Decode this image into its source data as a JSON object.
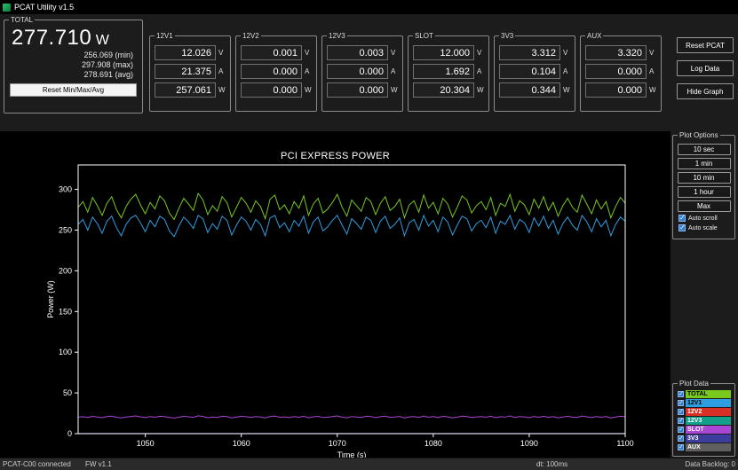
{
  "window": {
    "title": "PCAT Utility v1.5"
  },
  "total": {
    "label": "TOTAL",
    "value": "277.710",
    "unit": "W",
    "min": "256.069 (min)",
    "max": "297.908 (max)",
    "avg": "278.691 (avg)",
    "reset_button": "Reset Min/Max/Avg"
  },
  "units": {
    "volts": "V",
    "amps": "A",
    "watts": "W"
  },
  "channels": [
    {
      "label": "12V1",
      "volts": "12.026",
      "amps": "21.375",
      "watts": "257.061"
    },
    {
      "label": "12V2",
      "volts": "0.001",
      "amps": "0.000",
      "watts": "0.000"
    },
    {
      "label": "12V3",
      "volts": "0.003",
      "amps": "0.000",
      "watts": "0.000"
    },
    {
      "label": "SLOT",
      "volts": "12.000",
      "amps": "1.692",
      "watts": "20.304"
    },
    {
      "label": "3V3",
      "volts": "3.312",
      "amps": "0.104",
      "watts": "0.344"
    },
    {
      "label": "AUX",
      "volts": "3.320",
      "amps": "0.000",
      "watts": "0.000"
    }
  ],
  "actions": {
    "reset_pcat": "Reset PCAT",
    "log_data": "Log Data",
    "hide_graph": "Hide Graph"
  },
  "plot_options": {
    "label": "Plot Options",
    "buttons": [
      "10 sec",
      "1 min",
      "10 min",
      "1 hour",
      "Max"
    ],
    "checkboxes": [
      {
        "label": "Auto scroll",
        "checked": true
      },
      {
        "label": "Auto scale",
        "checked": true
      }
    ]
  },
  "plot_data": {
    "label": "Plot Data",
    "rows": [
      {
        "label": "TOTAL",
        "checked": true,
        "color": "#79c81e",
        "text_color": "#000000"
      },
      {
        "label": "12V1",
        "checked": true,
        "color": "#2f9ee0",
        "text_color": "#000000"
      },
      {
        "label": "12V2",
        "checked": true,
        "color": "#d93025",
        "text_color": "#ffffff"
      },
      {
        "label": "12V3",
        "checked": true,
        "color": "#12a08a",
        "text_color": "#ffffff"
      },
      {
        "label": "SLOT",
        "checked": true,
        "color": "#aa46d4",
        "text_color": "#ffffff"
      },
      {
        "label": "3V3",
        "checked": true,
        "color": "#3d3d9e",
        "text_color": "#ffffff"
      },
      {
        "label": "AUX",
        "checked": true,
        "color": "#606060",
        "text_color": "#ffffff"
      }
    ]
  },
  "statusbar": {
    "device": "PCAT-C00 connected",
    "firmware": "FW v1.1",
    "dt": "dt: 100ms",
    "backlog": "Data Backlog: 0"
  },
  "chart_data": {
    "type": "line",
    "title": "PCI EXPRESS POWER",
    "xlabel": "Time (s)",
    "ylabel": "Power (W)",
    "xlim": [
      1043,
      1100
    ],
    "ylim": [
      0,
      330
    ],
    "x_ticks": [
      1050,
      1060,
      1070,
      1080,
      1090,
      1100
    ],
    "y_ticks": [
      0,
      50,
      100,
      150,
      200,
      250,
      300
    ],
    "grid": false,
    "legend_position": "right-sidebar",
    "x": {
      "start": 1043,
      "step": 0.5,
      "count": 115
    },
    "series": [
      {
        "name": "12V2",
        "color": "#d93025",
        "values": 0.0
      },
      {
        "name": "12V3",
        "color": "#12a08a",
        "values": 0.0
      },
      {
        "name": "3V3",
        "color": "#3d3d9e",
        "values": 0.344
      },
      {
        "name": "AUX",
        "color": "#606060",
        "values": 0.0
      },
      {
        "name": "SLOT",
        "color": "#aa46d4",
        "values": [
          20.3,
          20.8,
          19.9,
          21.2,
          20.5,
          19.6,
          20.9,
          21.5,
          20.1,
          19.3,
          20.4,
          21.0,
          21.8,
          20.6,
          19.7,
          20.9,
          20.2,
          21.4,
          21.0,
          19.8,
          19.2,
          20.3,
          21.2,
          20.7,
          20.0,
          21.9,
          21.1,
          19.5,
          20.5,
          19.9,
          21.4,
          20.9,
          19.3,
          20.3,
          21.3,
          20.8,
          19.9,
          21.0,
          20.4,
          19.2,
          21.1,
          21.7,
          20.1,
          20.6,
          19.7,
          20.9,
          20.2,
          21.4,
          19.5,
          20.7,
          21.2,
          19.8,
          20.1,
          20.9,
          21.8,
          20.3,
          19.4,
          21.0,
          20.5,
          19.9,
          21.3,
          20.9,
          19.6,
          20.8,
          21.5,
          20.0,
          20.4,
          21.1,
          19.3,
          20.6,
          21.0,
          19.9,
          21.7,
          20.2,
          20.9,
          19.7,
          21.2,
          20.7,
          19.4,
          20.3,
          21.5,
          21.0,
          19.8,
          20.5,
          20.9,
          20.1,
          21.3,
          19.6,
          20.8,
          20.4,
          21.8,
          19.9,
          21.0,
          20.6,
          19.5,
          21.1,
          20.2,
          21.4,
          20.0,
          20.9,
          19.4,
          20.5,
          21.2,
          20.3,
          19.9,
          21.7,
          20.7,
          19.7,
          21.0,
          20.1,
          20.9,
          19.3,
          20.4,
          21.3,
          20.8
        ]
      },
      {
        "name": "12V1",
        "color": "#2f9ee0",
        "values": [
          257,
          263,
          250,
          266,
          258,
          246,
          261,
          267,
          253,
          243,
          257,
          265,
          268,
          259,
          248,
          262,
          254,
          267,
          263,
          249,
          242,
          255,
          266,
          260,
          252,
          268,
          264,
          247,
          258,
          251,
          267,
          262,
          244,
          256,
          266,
          261,
          250,
          263,
          257,
          243,
          265,
          268,
          253,
          259,
          248,
          262,
          255,
          267,
          246,
          260,
          266,
          249,
          254,
          262,
          268,
          256,
          245,
          264,
          258,
          251,
          266,
          262,
          247,
          261,
          267,
          252,
          257,
          265,
          243,
          259,
          263,
          250,
          268,
          255,
          262,
          248,
          266,
          260,
          244,
          256,
          267,
          264,
          249,
          258,
          262,
          253,
          266,
          246,
          261,
          257,
          268,
          251,
          263,
          259,
          247,
          265,
          255,
          267,
          252,
          262,
          245,
          258,
          266,
          256,
          250,
          268,
          260,
          248,
          264,
          254,
          262,
          243,
          257,
          266,
          261
        ]
      },
      {
        "name": "TOTAL",
        "color": "#79c81e",
        "values": [
          278,
          285,
          272,
          290,
          280,
          268,
          283,
          291,
          275,
          265,
          279,
          288,
          294,
          281,
          270,
          284,
          276,
          292,
          286,
          271,
          263,
          277,
          289,
          282,
          274,
          295,
          287,
          269,
          280,
          273,
          291,
          284,
          266,
          278,
          290,
          283,
          272,
          286,
          279,
          264,
          288,
          293,
          275,
          281,
          270,
          285,
          277,
          292,
          268,
          282,
          289,
          271,
          276,
          284,
          294,
          278,
          267,
          287,
          280,
          273,
          290,
          285,
          269,
          283,
          291,
          274,
          279,
          288,
          265,
          281,
          286,
          272,
          293,
          277,
          284,
          270,
          289,
          282,
          266,
          278,
          292,
          287,
          271,
          280,
          285,
          275,
          290,
          268,
          283,
          279,
          294,
          273,
          286,
          281,
          269,
          288,
          277,
          291,
          274,
          284,
          267,
          280,
          289,
          278,
          272,
          293,
          282,
          270,
          287,
          276,
          285,
          265,
          279,
          290,
          283
        ]
      }
    ]
  }
}
